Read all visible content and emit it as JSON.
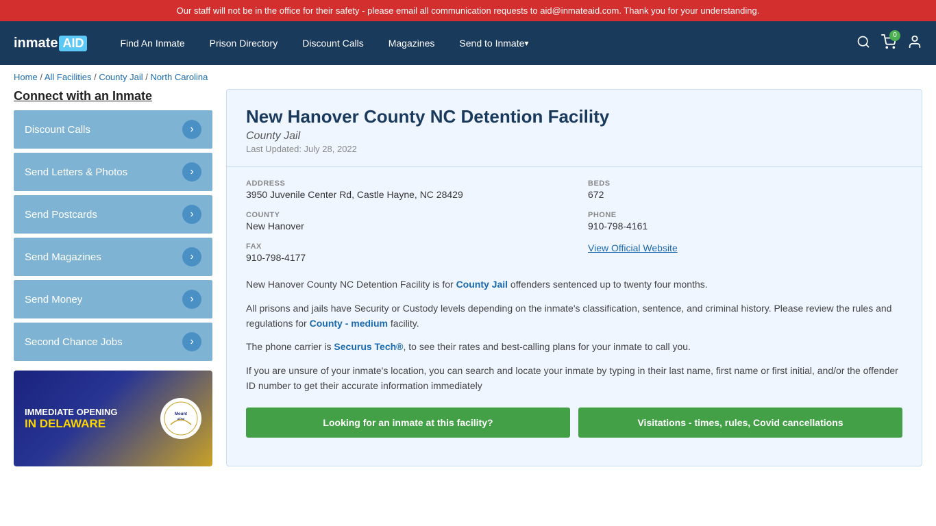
{
  "alert": {
    "text": "Our staff will not be in the office for their safety - please email all communication requests to aid@inmateaid.com. Thank you for your understanding."
  },
  "header": {
    "logo": "inmateAID",
    "logo_part1": "inmate",
    "logo_part2": "AID",
    "nav": [
      {
        "label": "Find An Inmate",
        "id": "find-inmate",
        "dropdown": false
      },
      {
        "label": "Prison Directory",
        "id": "prison-directory",
        "dropdown": false
      },
      {
        "label": "Discount Calls",
        "id": "discount-calls",
        "dropdown": false
      },
      {
        "label": "Magazines",
        "id": "magazines",
        "dropdown": false
      },
      {
        "label": "Send to Inmate",
        "id": "send-to-inmate",
        "dropdown": true
      }
    ],
    "cart_count": "0"
  },
  "breadcrumb": {
    "items": [
      "Home",
      "All Facilities",
      "County Jail",
      "North Carolina"
    ],
    "separator": "/"
  },
  "sidebar": {
    "title": "Connect with an Inmate",
    "buttons": [
      {
        "label": "Discount Calls",
        "id": "discount-calls-btn"
      },
      {
        "label": "Send Letters & Photos",
        "id": "send-letters-btn"
      },
      {
        "label": "Send Postcards",
        "id": "send-postcards-btn"
      },
      {
        "label": "Send Magazines",
        "id": "send-magazines-btn"
      },
      {
        "label": "Send Money",
        "id": "send-money-btn"
      },
      {
        "label": "Second Chance Jobs",
        "id": "second-chance-jobs-btn"
      }
    ],
    "ad": {
      "line1": "IMMEDIATE OPENING",
      "line2": "IN DELAWARE",
      "logo_text": "Mountaire"
    }
  },
  "facility": {
    "name": "New Hanover County NC Detention Facility",
    "type": "County Jail",
    "last_updated": "Last Updated: July 28, 2022",
    "address_label": "ADDRESS",
    "address_value": "3950 Juvenile Center Rd, Castle Hayne, NC 28429",
    "beds_label": "BEDS",
    "beds_value": "672",
    "county_label": "COUNTY",
    "county_value": "New Hanover",
    "phone_label": "PHONE",
    "phone_value": "910-798-4161",
    "fax_label": "FAX",
    "fax_value": "910-798-4177",
    "website_label": "View Official Website",
    "desc1": "New Hanover County NC Detention Facility is for County Jail offenders sentenced up to twenty four months.",
    "desc2": "All prisons and jails have Security or Custody levels depending on the inmate's classification, sentence, and criminal history. Please review the rules and regulations for County - medium facility.",
    "desc3": "The phone carrier is Securus Tech®, to see their rates and best-calling plans for your inmate to call you.",
    "desc4": "If you are unsure of your inmate's location, you can search and locate your inmate by typing in their last name, first name or first initial, and/or the offender ID number to get their accurate information immediately",
    "btn1": "Looking for an inmate at this facility?",
    "btn2": "Visitations - times, rules, Covid cancellations"
  }
}
